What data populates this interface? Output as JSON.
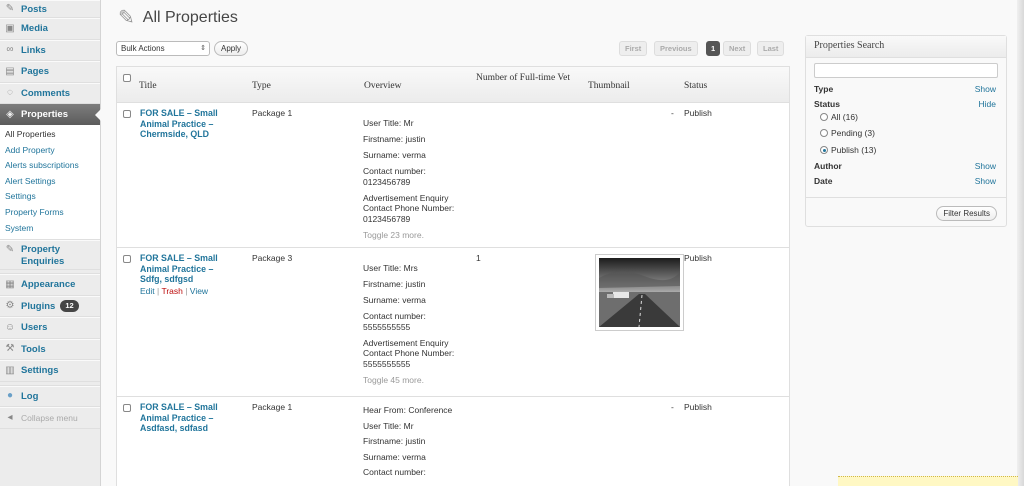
{
  "sidebar": {
    "items": [
      {
        "label": "Posts",
        "icon": "pushpin-icon"
      },
      {
        "label": "Media",
        "icon": "media-icon"
      },
      {
        "label": "Links",
        "icon": "link-icon"
      },
      {
        "label": "Pages",
        "icon": "page-icon"
      },
      {
        "label": "Comments",
        "icon": "comment-icon"
      },
      {
        "label": "Properties",
        "icon": "properties-icon"
      }
    ],
    "submenu": [
      "All Properties",
      "Add Property",
      "Alerts subscriptions",
      "Alert Settings",
      "Settings",
      "Property Forms",
      "System"
    ],
    "items2": [
      {
        "label": "Property Enquiries",
        "icon": "pushpin-icon"
      },
      {
        "label": "Appearance",
        "icon": "appearance-icon"
      },
      {
        "label": "Plugins",
        "icon": "plugin-icon",
        "badge": "12"
      },
      {
        "label": "Users",
        "icon": "users-icon"
      },
      {
        "label": "Tools",
        "icon": "tools-icon"
      },
      {
        "label": "Settings",
        "icon": "settings-icon"
      },
      {
        "label": "Log",
        "icon": "log-icon"
      }
    ],
    "collapse": "Collapse menu"
  },
  "header": {
    "title": "All Properties"
  },
  "toolbar": {
    "bulk": "Bulk Actions",
    "apply": "Apply",
    "pagination": {
      "first": "First",
      "previous": "Previous",
      "current": "1",
      "next": "Next",
      "last": "Last"
    }
  },
  "table": {
    "columns": [
      "Title",
      "Type",
      "Overview",
      "Number of Full-time Vet",
      "Thumbnail",
      "Status"
    ],
    "rows": [
      {
        "title": "FOR SALE – Small Animal Practice – Chermside, QLD",
        "type": "Package 1",
        "overview": [
          "User Title: Mr",
          "Firstname: justin",
          "Surname: verma",
          "Contact number: 0123456789",
          "Advertisement Enquiry Contact Phone Number: 0123456789"
        ],
        "toggle": "Toggle 23 more.",
        "vets": "",
        "dash": "-",
        "status": "Publish"
      },
      {
        "title": "FOR SALE – Small Animal Practice – Sdfg, sdfgsd",
        "actions": {
          "edit": "Edit",
          "trash": "Trash",
          "view": "View"
        },
        "type": "Package 3",
        "overview": [
          "User Title: Mrs",
          "Firstname: justin",
          "Surname: verma",
          "Contact number: 5555555555",
          "Advertisement Enquiry Contact Phone Number: 5555555555"
        ],
        "toggle": "Toggle 45 more.",
        "vets": "1",
        "status": "Publish"
      },
      {
        "title": "FOR SALE – Small Animal Practice – Asdfasd, sdfasd",
        "type": "Package 1",
        "overview": [
          "Hear From: Conference",
          "User Title: Mr",
          "Firstname: justin",
          "Surname: verma",
          "Contact number:"
        ],
        "vets": "",
        "dash": "-",
        "status": "Publish"
      }
    ]
  },
  "panel": {
    "title": "Properties Search",
    "type_label": "Type",
    "type_link": "Show",
    "status_label": "Status",
    "status_link": "Hide",
    "status_options": [
      "All (16)",
      "Pending (3)",
      "Publish (13)"
    ],
    "author_label": "Author",
    "author_link": "Show",
    "date_label": "Date",
    "date_link": "Show",
    "filter": "Filter Results"
  }
}
